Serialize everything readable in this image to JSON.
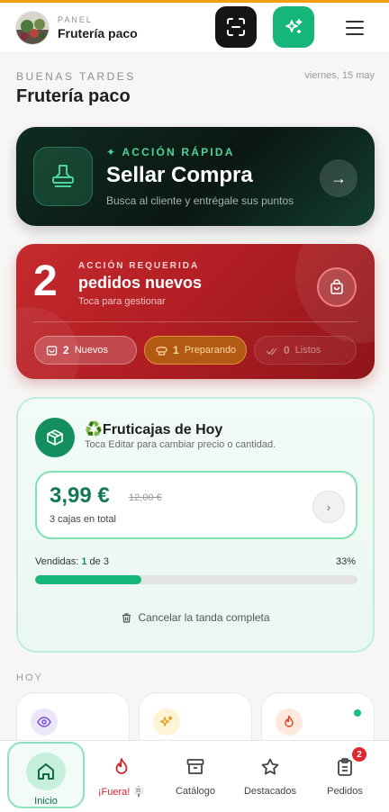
{
  "header": {
    "kicker": "PANEL",
    "store_name": "Frutería paco",
    "menu_icon": "hamburger-icon"
  },
  "greeting": {
    "text": "BUENAS TARDES",
    "date": "viernes, 15 may",
    "title": "Frutería paco"
  },
  "quick_action": {
    "kicker": "✦ ACCIÓN RÁPIDA",
    "title": "Sellar Compra",
    "subtitle": "Busca al cliente y entrégale sus puntos",
    "arrow": "→"
  },
  "orders": {
    "count": "2",
    "kicker": "ACCIÓN REQUERIDA",
    "title": "pedidos nuevos",
    "subtitle": "Toca para gestionar",
    "pills": [
      {
        "count": "2",
        "label": "Nuevos"
      },
      {
        "count": "1",
        "label": "Preparando"
      },
      {
        "count": "0",
        "label": "Listos"
      }
    ]
  },
  "fruit_boxes": {
    "title": "♻️Fruticajas de Hoy",
    "subtitle": "Toca Editar para cambiar precio o cantidad.",
    "price": "3,99 €",
    "old_price": "12,00 €",
    "boxes_total": "3 cajas en total",
    "sold_prefix": "Vendidas: ",
    "sold_count": "1",
    "sold_suffix": " de 3",
    "percent_label": "33%",
    "progress": 0.33,
    "cancel_label": "Cancelar la tanda completa"
  },
  "today": {
    "label": "HOY"
  },
  "colors": {
    "accent_green": "#16b57a",
    "alert_red": "#c52a2e",
    "dark_card": "#0b1712",
    "top_bar": "#f59e0b"
  },
  "nav": {
    "tabs": [
      {
        "label": "Inicio",
        "icon": "home-icon"
      },
      {
        "label": "¡Fuera! 🪧",
        "icon": "flame-icon"
      },
      {
        "label": "Catálogo",
        "icon": "archive-icon"
      },
      {
        "label": "Destacados",
        "icon": "star-icon"
      },
      {
        "label": "Pedidos",
        "icon": "clipboard-icon",
        "badge": "2"
      }
    ]
  }
}
